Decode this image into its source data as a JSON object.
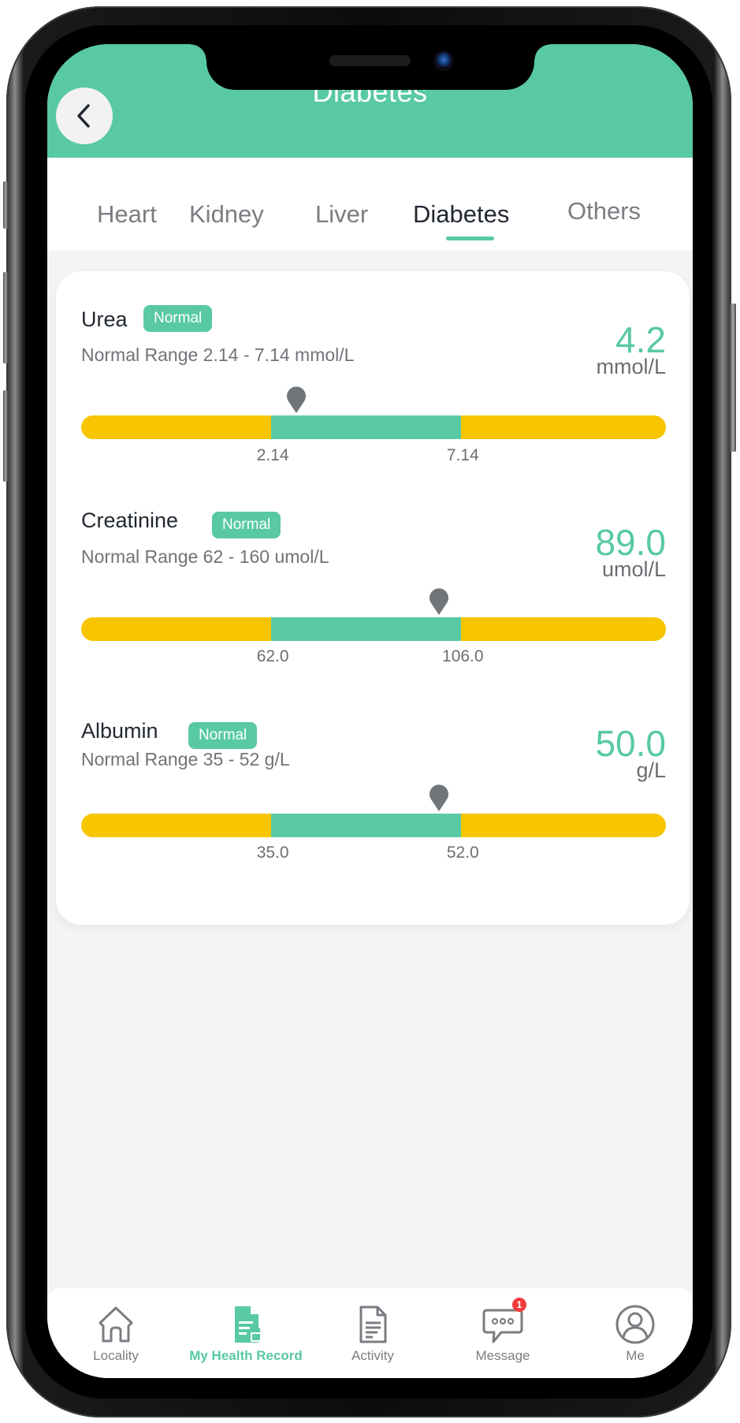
{
  "header": {
    "title": "Diabetes",
    "back_icon": "chevron-left-icon"
  },
  "tabs": [
    {
      "label": "Heart",
      "active": false
    },
    {
      "label": "Kidney",
      "active": false
    },
    {
      "label": "Liver",
      "active": false
    },
    {
      "label": "Diabetes",
      "active": true
    },
    {
      "label": "Others",
      "active": false
    }
  ],
  "colors": {
    "accent": "#58c9a4",
    "out_of_range": "#f7c600",
    "marker": "#70757a",
    "notification": "#f23b3b"
  },
  "metrics": [
    {
      "name": "Urea",
      "status": "Normal",
      "range_text": "Normal Range 2.14 - 7.14 mmol/L",
      "value": "4.2",
      "unit": "mmol/L",
      "low_label": "2.14",
      "high_label": "7.14",
      "marker_fraction": 0.368
    },
    {
      "name": "Creatinine",
      "status": "Normal",
      "range_text": "Normal Range 62 - 160 umol/L",
      "value": "89.0",
      "unit": "umol/L",
      "low_label": "62.0",
      "high_label": "106.0",
      "marker_fraction": 0.612
    },
    {
      "name": "Albumin",
      "status": "Normal",
      "range_text": "Normal Range 35 - 52 g/L",
      "value": "50.0",
      "unit": "g/L",
      "low_label": "35.0",
      "high_label": "52.0",
      "marker_fraction": 0.612
    }
  ],
  "bar": {
    "normal_start_fraction": 0.325,
    "normal_end_fraction": 0.65
  },
  "bottom_nav": [
    {
      "label": "Locality",
      "icon": "home-icon",
      "active": false
    },
    {
      "label": "My Health Record",
      "icon": "health-record-icon",
      "active": true
    },
    {
      "label": "Activity",
      "icon": "document-icon",
      "active": false
    },
    {
      "label": "Message",
      "icon": "chat-icon",
      "active": false,
      "badge": "1"
    },
    {
      "label": "Me",
      "icon": "user-icon",
      "active": false
    }
  ]
}
